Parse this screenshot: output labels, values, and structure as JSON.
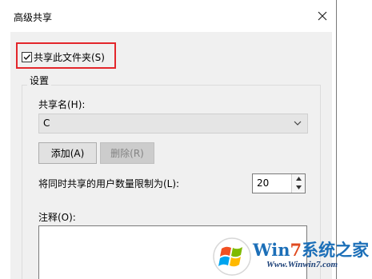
{
  "window": {
    "title": "高级共享"
  },
  "share_checkbox": {
    "label": "共享此文件夹(S)",
    "checked": true
  },
  "settings": {
    "group_title": "设置",
    "share_name_label": "共享名(H):",
    "share_name_value": "C",
    "add_button": "添加(A)",
    "delete_button": "删除(R)",
    "user_limit_label": "将同时共享的用户数量限制为(L):",
    "user_limit_value": "20",
    "comment_label": "注释(O):",
    "comment_value": ""
  },
  "watermark": {
    "brand_prefix": "Win",
    "brand_seven": "7",
    "brand_suffix": "系统之家",
    "url": "Www.Winwin7.com"
  },
  "colors": {
    "highlight": "#e3262b",
    "client_bg": "#f0f0f0",
    "watermark_blue": "#1c6fb8",
    "watermark_orange": "#e04a1f"
  },
  "icons": [
    "close-icon",
    "checkbox-checked-icon",
    "chevron-down-icon",
    "spin-up-icon",
    "spin-down-icon",
    "windows-logo-icon"
  ]
}
